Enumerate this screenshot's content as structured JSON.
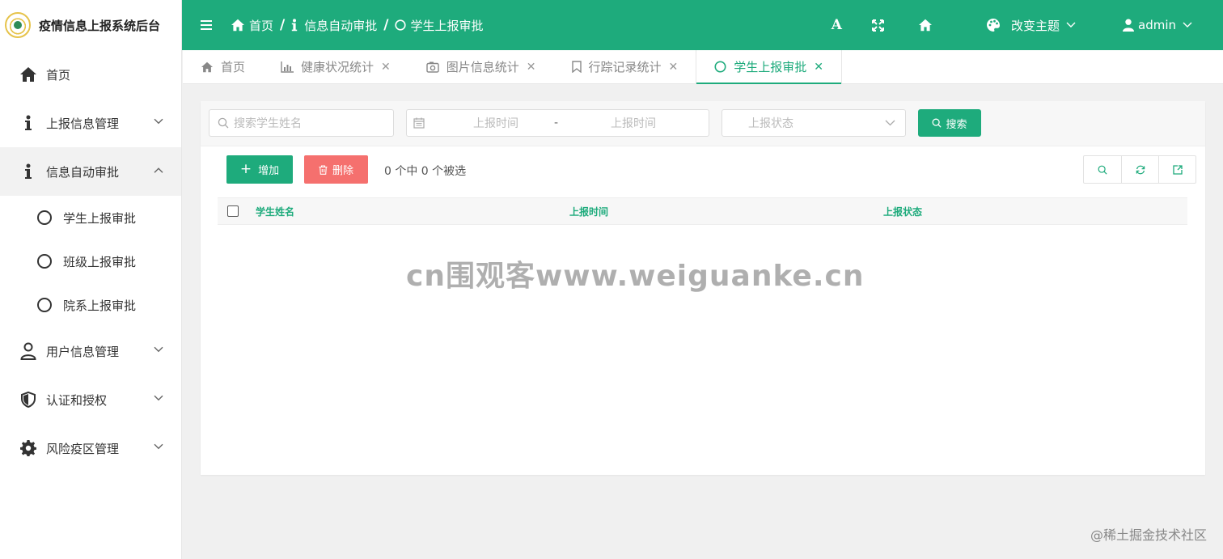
{
  "brand": {
    "title": "疫情信息上报系统后台",
    "logo_icon": "school-emblem-logo"
  },
  "sidebar": {
    "items": [
      {
        "label": "首页",
        "icon": "home-icon"
      },
      {
        "label": "上报信息管理",
        "icon": "info-icon"
      },
      {
        "label": "信息自动审批",
        "icon": "info-icon",
        "expanded": true,
        "children": [
          {
            "label": "学生上报审批"
          },
          {
            "label": "班级上报审批"
          },
          {
            "label": "院系上报审批"
          }
        ]
      },
      {
        "label": "用户信息管理",
        "icon": "user-icon"
      },
      {
        "label": "认证和授权",
        "icon": "shield-icon"
      },
      {
        "label": "风险疫区管理",
        "icon": "gear-icon"
      }
    ]
  },
  "header": {
    "breadcrumb": [
      "首页",
      "信息自动审批",
      "学生上报审批"
    ],
    "font_button": "A",
    "theme_label": "改变主题",
    "user_label": "admin",
    "accent_color": "#1eab7c"
  },
  "tabs": [
    {
      "label": "首页",
      "icon": "home-icon",
      "closable": false
    },
    {
      "label": "健康状况统计",
      "icon": "bar-chart-icon",
      "closable": true
    },
    {
      "label": "图片信息统计",
      "icon": "camera-icon",
      "closable": true
    },
    {
      "label": "行踪记录统计",
      "icon": "bookmark-icon",
      "closable": true
    },
    {
      "label": "学生上报审批",
      "icon": "circle-icon",
      "closable": true,
      "active": true
    }
  ],
  "filters": {
    "name_placeholder": "搜索学生姓名",
    "date_start_placeholder": "上报时间",
    "date_separator": "-",
    "date_end_placeholder": "上报时间",
    "status_placeholder": "上报状态",
    "search_label": "搜索"
  },
  "toolbar": {
    "add_label": "增加",
    "delete_label": "删除",
    "selection_info": "0 个中 0 个被选",
    "delete_color": "#f5706e"
  },
  "table": {
    "columns": [
      "学生姓名",
      "上报时间",
      "上报状态"
    ],
    "rows": []
  },
  "watermark": "cn围观客www.weiguanke.cn",
  "footer_mark": "@稀土掘金技术社区"
}
